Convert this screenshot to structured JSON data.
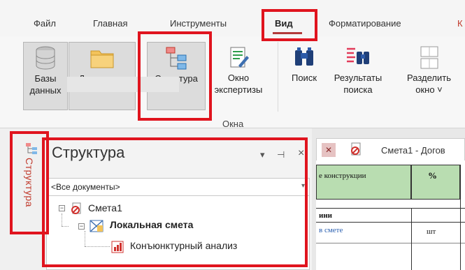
{
  "ribbon_tabs": [
    "Файл",
    "Главная",
    "Инструменты",
    "Вид",
    "Форматирование",
    "К"
  ],
  "ribbon_buttons": {
    "databases": "Базы\nданных",
    "documents": "Документы",
    "structure": "Структура",
    "expert_window": "Окно\nэкспертизы",
    "search": "Поиск",
    "search_results": "Результаты\nпоиска",
    "split_window": "Разделить\nокно ˅"
  },
  "group_label": "Окна",
  "side_tab_label": "Структура",
  "panel": {
    "title": "Структура",
    "dropdown_icon": "▾",
    "pin_icon": "⊣",
    "close_icon": "×",
    "doc_select_value": "<Все документы>",
    "tree": {
      "root": "Смета1",
      "child": "Локальная смета",
      "grandchild": "Конъюнктурный анализ"
    }
  },
  "document": {
    "tab_title": "Смета1 - Догов",
    "col_name": "е конструкции",
    "col_percent": "%",
    "row_header": "ини",
    "row_text": "в смете",
    "row_unit": "шт"
  },
  "colors": {
    "highlight": "#e0141e",
    "accent": "#b23a3a",
    "sheet_header": "#b9ddb1"
  }
}
